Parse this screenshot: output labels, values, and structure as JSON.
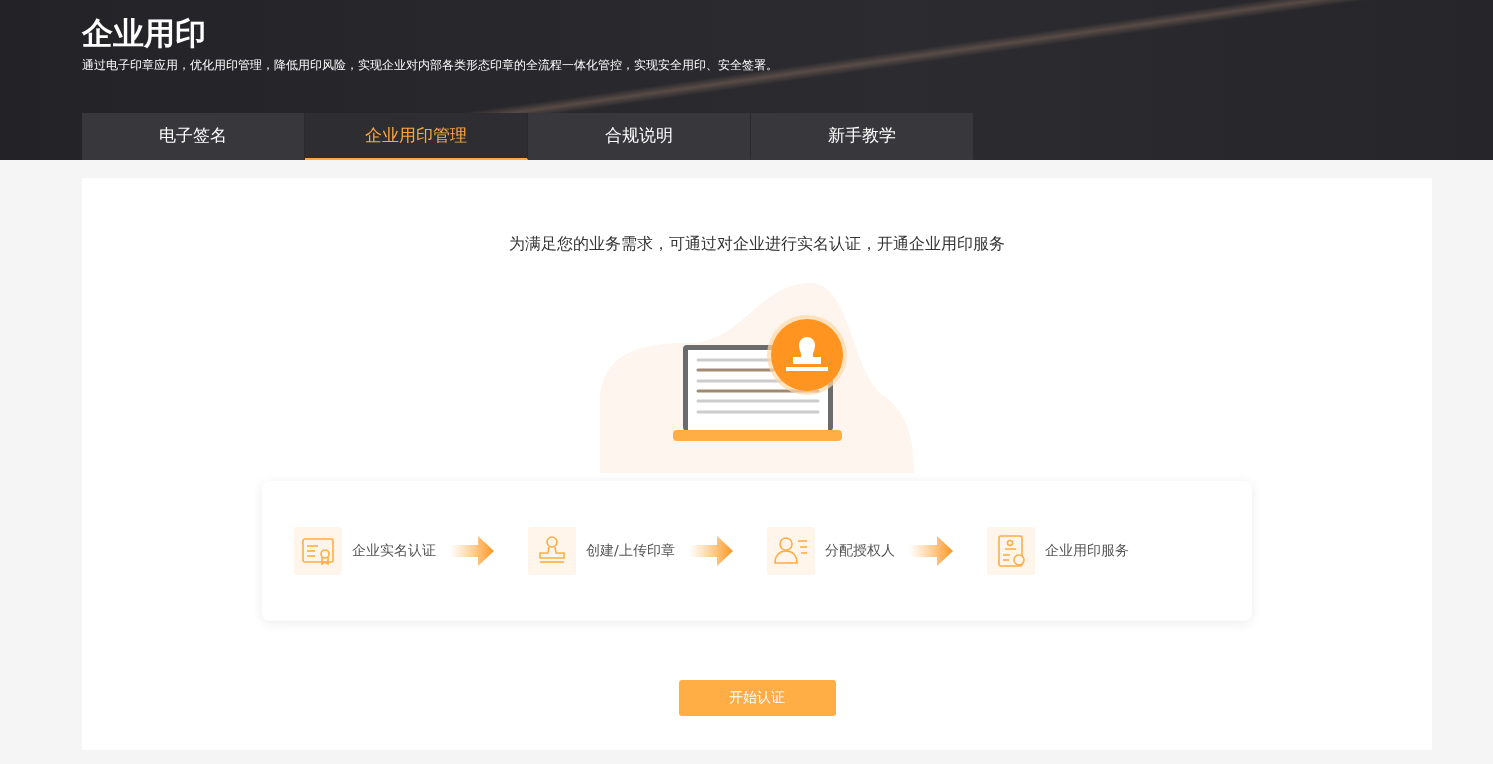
{
  "header": {
    "title": "企业用印",
    "subtitle": "通过电子印章应用，优化用印管理，降低用印风险，实现企业对内部各类形态印章的全流程一体化管控，实现安全用印、安全签署。"
  },
  "tabs": [
    {
      "label": "电子签名",
      "selected": false
    },
    {
      "label": "企业用印管理",
      "selected": true
    },
    {
      "label": "合规说明",
      "selected": false
    },
    {
      "label": "新手教学",
      "selected": false
    }
  ],
  "intro": "为满足您的业务需求，可通过对企业进行实名认证，开通企业用印服务",
  "steps": [
    {
      "kind": "certificate",
      "label": "企业实名认证"
    },
    {
      "kind": "stamp",
      "label": "创建/上传印章"
    },
    {
      "kind": "person",
      "label": "分配授权人"
    },
    {
      "kind": "document",
      "label": "企业用印服务"
    }
  ],
  "start_button": "开始认证"
}
